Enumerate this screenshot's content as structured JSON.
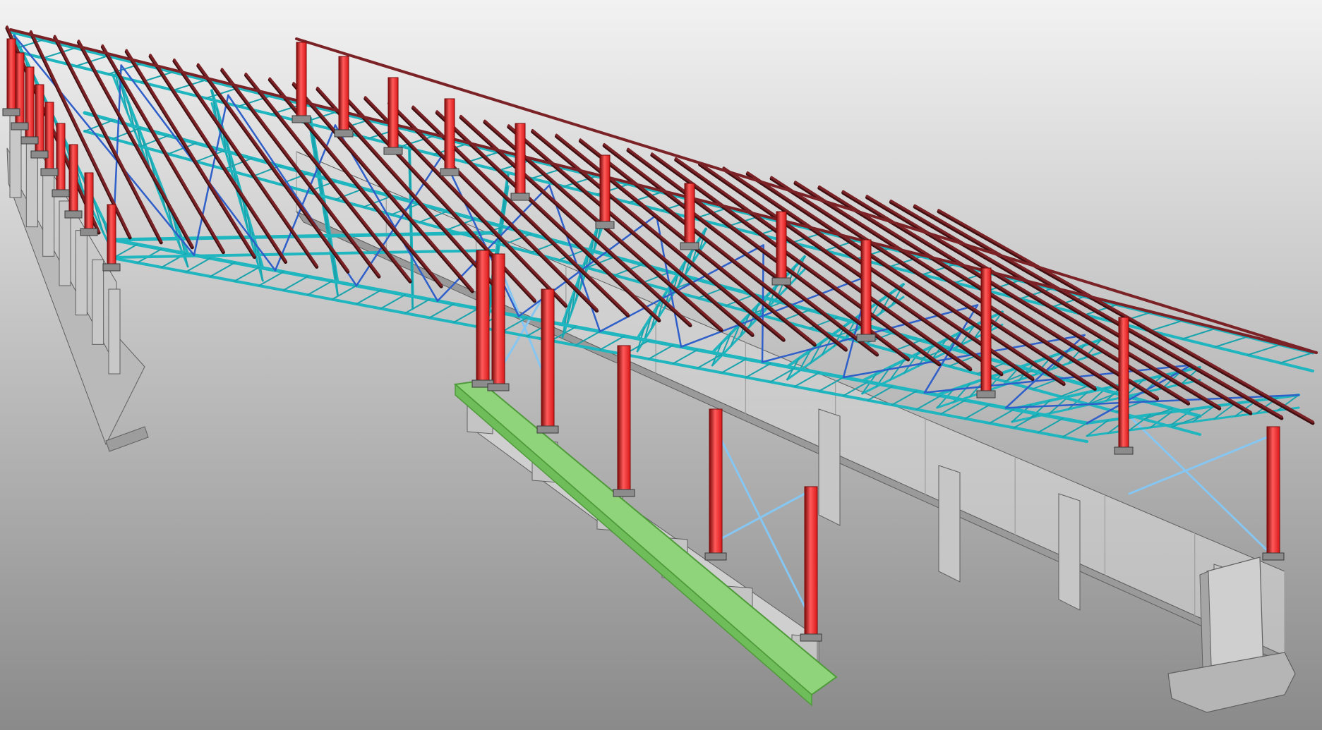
{
  "viewport": {
    "background_top": "#f2f2f2",
    "background_bottom": "#8a8a8a"
  },
  "colors": {
    "column_steel": "#d81818",
    "column_steel_dark": "#7a0a0a",
    "column_highlight": "#ff5a5a",
    "purlin": "#7a2226",
    "purlin_dark": "#3e0e10",
    "truss_chord": "#1fb6bf",
    "truss_web": "#19a3ad",
    "truss_dark": "#0d6e74",
    "roof_bracing": "#2f5fc9",
    "wall_bracing": "#86c6f2",
    "concrete": "#cfcfcf",
    "concrete_shadow": "#a9a9a9",
    "concrete_edge": "#5f5f5f",
    "selected_footing": "#8fd47a",
    "selected_edge": "#4f9a3a"
  },
  "icons": {
    "selection": "selected-footing-highlight"
  }
}
